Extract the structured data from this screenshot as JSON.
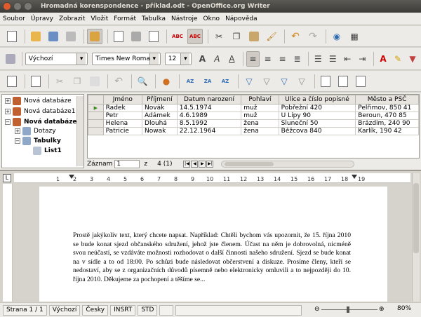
{
  "window": {
    "title": "Hromadná korenspondence - příklad.odt - OpenOffice.org Writer"
  },
  "menu": [
    "Soubor",
    "Úpravy",
    "Zobrazit",
    "Vložit",
    "Formát",
    "Tabulka",
    "Nástroje",
    "Okno",
    "Nápověda"
  ],
  "formatting": {
    "style": "Výchozí",
    "font": "Times New Roman",
    "size": "12"
  },
  "datasources": {
    "tree": [
      {
        "label": "Nová databáze",
        "expanded": false
      },
      {
        "label": "Nová databáze1",
        "expanded": false
      },
      {
        "label": "Nová databáze",
        "expanded": true,
        "bold": true
      },
      {
        "label": "Dotazy",
        "expanded": false
      },
      {
        "label": "Tabulky",
        "expanded": true,
        "bold": true
      },
      {
        "label": "List1",
        "bold": true
      }
    ],
    "columns": [
      "Jméno",
      "Příjmení",
      "Datum narození",
      "Pohlaví",
      "Ulice a číslo popisné",
      "Město a PSČ"
    ],
    "rows": [
      [
        "Radek",
        "Novák",
        "14.5.1974",
        "muž",
        "Pobřežní 420",
        "Pelřimov, 850 41"
      ],
      [
        "Petr",
        "Adámek",
        "4.6.1989",
        "muž",
        "U Lípy 90",
        "Beroun, 470 85"
      ],
      [
        "Helena",
        "Dlouhá",
        "8.5.1992",
        "žena",
        "Sluneční 50",
        "Brázdim, 240 90"
      ],
      [
        "Patricie",
        "Nowak",
        "22.12.1964",
        "žena",
        "Běžcova 840",
        "Karlík, 190 42"
      ]
    ],
    "record_label": "Záznam",
    "record_value": "1",
    "of_label": "z",
    "of_value": "4 (1)"
  },
  "ruler": {
    "ticks": [
      "1",
      "2",
      "3",
      "4",
      "5",
      "6",
      "7",
      "8",
      "9",
      "10",
      "11",
      "12",
      "13",
      "14",
      "15",
      "16",
      "17",
      "18",
      "19"
    ]
  },
  "document": {
    "text": "Prostě jakýkoliv text, který chcete napsat. Například: Chtěli bychom vás upozornit, že 15. října 2010 se bude konat sjezd občanského sdružení, jehož jste členem. Účast na něm je dobrovolná, nicméně svou neúčastí, se vzdáváte možnosti rozhodovat o další činnosti našeho sdružení. Sjezd se bude konat na v sídle a to od 18:00. Po schůzi bude následovat občerstvení a diskuze. Prosíme členy, kteří se nedostaví, aby se z organizačních důvodů písemně nebo elektronicky omluvili a to nejpozději do 10. října 2010. Děkujeme za pochopení a těšíme se..."
  },
  "status": {
    "page": "Strana 1 / 1",
    "style": "Výchozí",
    "language": "Česky",
    "insert": "INSRT",
    "selection": "STD",
    "zoom": "80%"
  }
}
